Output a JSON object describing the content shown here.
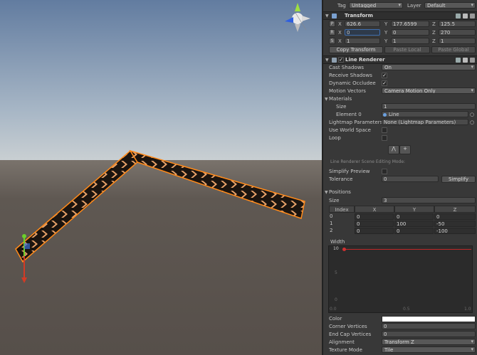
{
  "header": {
    "tag_label": "Tag",
    "tag_value": "Untagged",
    "layer_label": "Layer",
    "layer_value": "Default"
  },
  "transform": {
    "title": "Transform",
    "position": {
      "x": "626.6",
      "y": "177.6599",
      "z": "125.5"
    },
    "rotation": {
      "x": "0",
      "y": "0",
      "z": "270"
    },
    "scale": {
      "x": "1",
      "y": "1",
      "z": "1"
    },
    "buttons": [
      "Copy Transform",
      "Paste Local",
      "Paste Global"
    ]
  },
  "line_renderer": {
    "title": "Line Renderer",
    "cast_shadows_label": "Cast Shadows",
    "cast_shadows_value": "On",
    "receive_shadows_label": "Receive Shadows",
    "dynamic_occludee_label": "Dynamic Occludee",
    "motion_vectors_label": "Motion Vectors",
    "motion_vectors_value": "Camera Motion Only",
    "materials_label": "Materials",
    "size_label": "Size",
    "size_value": "1",
    "element0_label": "Element 0",
    "element0_value": "Line",
    "lightmap_label": "Lightmap Parameters",
    "lightmap_value": "None (Lightmap Parameters)",
    "world_space_label": "Use World Space",
    "loop_label": "Loop",
    "edit_mode_label": "Line Renderer Scene Editing Mode:",
    "simplify_preview_label": "Simplify Preview",
    "tolerance_label": "Tolerance",
    "tolerance_value": "0",
    "simplify_button": "Simplify",
    "positions_label": "Positions",
    "pos_size_label": "Size",
    "pos_size_value": "3",
    "table_headers": [
      "Index",
      "X",
      "Y",
      "Z"
    ],
    "rows": [
      [
        "0",
        "0",
        "0",
        "0"
      ],
      [
        "1",
        "0",
        "100",
        "-50"
      ],
      [
        "2",
        "0",
        "0",
        "-100"
      ]
    ],
    "width_label": "Width",
    "width_value": "10",
    "graph_y_labels": [
      "10",
      "5",
      "0"
    ],
    "graph_x_labels": [
      "0.0",
      "0.5",
      "1.0"
    ],
    "color_label": "Color",
    "color_value": "#ffffff",
    "corner_vertices_label": "Corner Vertices",
    "corner_vertices_value": "0",
    "end_cap_label": "End Cap Vertices",
    "end_cap_value": "0",
    "alignment_label": "Alignment",
    "alignment_value": "Transform Z",
    "texture_mode_label": "Texture Mode",
    "texture_mode_value": "Tile"
  },
  "axes": {
    "P": "P",
    "R": "R",
    "S": "S",
    "X": "X",
    "Y": "Y",
    "Z": "Z"
  },
  "colors": {
    "accent_orange": "#ff8a1a",
    "sky_top": "#6f87a8",
    "ground": "#5d5650",
    "curve_red": "#d03030"
  }
}
